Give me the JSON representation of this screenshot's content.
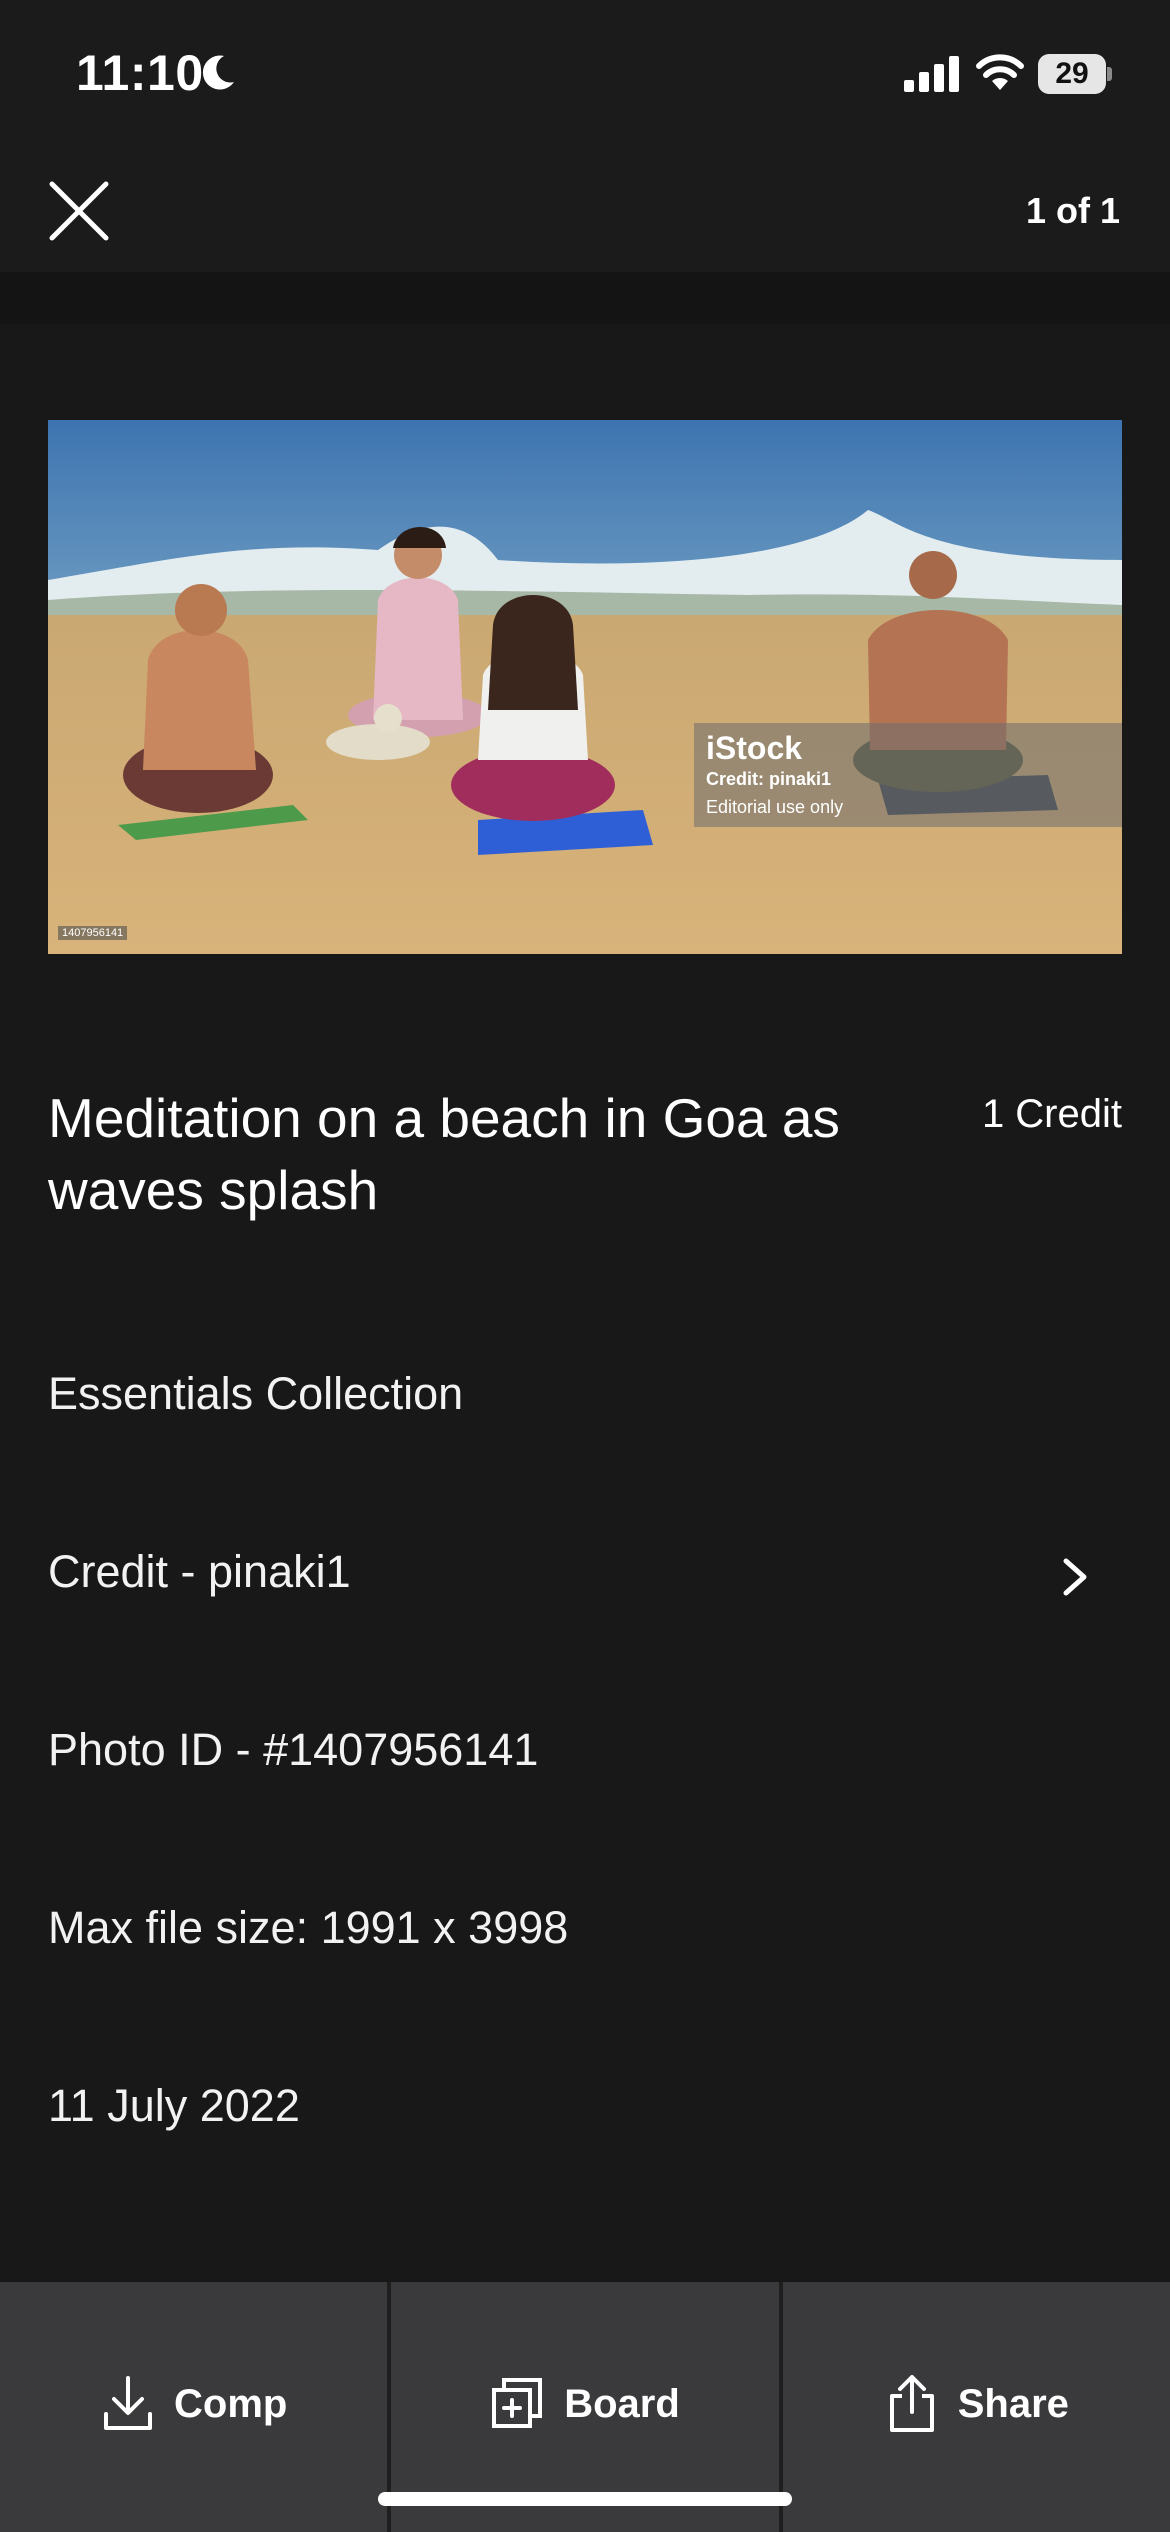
{
  "status_bar": {
    "time": "11:10",
    "battery_level": "29",
    "icons": [
      "moon-icon",
      "cellular-signal-icon",
      "wifi-icon",
      "battery-icon"
    ]
  },
  "header": {
    "close_icon": "close-icon",
    "page_counter": "1 of 1"
  },
  "photo": {
    "watermark_brand": "iStock",
    "watermark_credit": "Credit: pinaki1",
    "watermark_editorial": "Editorial use only",
    "corner_id": "1407956141"
  },
  "details": {
    "title": "Meditation on a beach in Goa as waves splash",
    "price": "1 Credit",
    "collection": "Essentials Collection",
    "credit": "Credit - pinaki1",
    "photo_id": "Photo ID - #1407956141",
    "max_file_size": "Max file size: 1991 x 3998",
    "date": "11 July 2022"
  },
  "toolbar": {
    "comp_label": "Comp",
    "board_label": "Board",
    "share_label": "Share"
  },
  "colors": {
    "background": "#181819",
    "toolbar": "#3a3a3c",
    "text": "#ffffff"
  }
}
